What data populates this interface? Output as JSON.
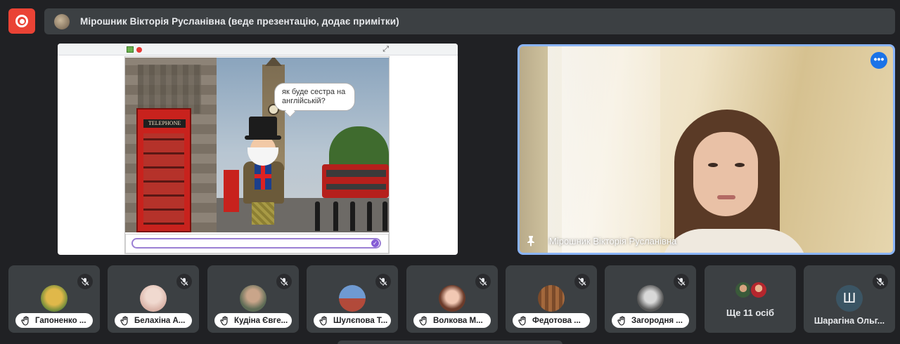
{
  "presenter_bar": {
    "title": "Мірошник Вікторія Русланівна (веде презентацію, додає примітки)"
  },
  "presentation": {
    "speech_bubble": "як буде сестра на англійській?",
    "phonebox_sign": "TELEPHONE"
  },
  "main_video": {
    "name": "Мірошник Вікторія Русланівна",
    "more_options": "•••"
  },
  "participants": [
    {
      "name": "Гапоненко ..."
    },
    {
      "name": "Белахіна А..."
    },
    {
      "name": "Кудіна Євге..."
    },
    {
      "name": "Шулєпова Т..."
    },
    {
      "name": "Волкова М..."
    },
    {
      "name": "Федотова ..."
    },
    {
      "name": "Загородня ..."
    }
  ],
  "more_people": {
    "label": "Ще 11 осіб"
  },
  "last_participant": {
    "initial": "Ш",
    "name": "Шарагіна Ольг..."
  },
  "colors": {
    "record": "#ea4335",
    "active_speaker_border": "#8ab4f8",
    "tile_bg": "#3c4043",
    "page_bg": "#202124"
  }
}
